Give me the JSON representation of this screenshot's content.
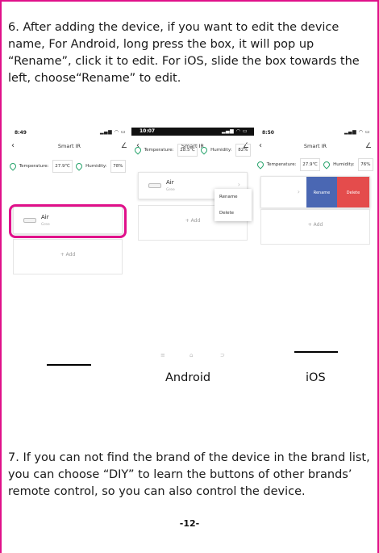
{
  "paragraphs": {
    "step6": "6. After adding the device, if you want to edit the device name, For Android, long press the box, it will pop up “Rename”, click it to edit. For iOS, slide the box towards the left, choose“Rename” to edit.",
    "step7": "7.  If you can not find the brand of the device in the brand list, you can choose “DIY” to learn the buttons of other brands’ remote control,  so you can also control the device."
  },
  "phones": {
    "ios_left": {
      "time": "8:49",
      "title": "Smart IR",
      "temperature_label": "Temperature:",
      "temperature_value": "27.9℃",
      "humidity_label": "Humidity:",
      "humidity_value": "78%",
      "device_name": "Air",
      "device_sub": "Gree",
      "add_label": "+ Add"
    },
    "android": {
      "time": "10:07",
      "title": "Smart IR",
      "temperature_label": "Temperature:",
      "temperature_value": "28.5℃",
      "humidity_label": "Humidity:",
      "humidity_value": "82%",
      "device_name": "Air",
      "device_sub": "Gree",
      "menu_rename": "Rename",
      "menu_delete": "Delete",
      "add_label": "+ Add"
    },
    "ios_right": {
      "time": "8:50",
      "title": "Smart IR",
      "temperature_label": "Temperature:",
      "temperature_value": "27.9℃",
      "humidity_label": "Humidity:",
      "humidity_value": "76%",
      "swipe_rename": "Rename",
      "swipe_delete": "Delete",
      "add_label": "+ Add"
    }
  },
  "captions": {
    "android": "Android",
    "ios": "iOS"
  },
  "page_number": "-12-",
  "colors": {
    "frame": "#e0108a",
    "rename_action": "#4a67b3",
    "delete_action": "#e44c4c",
    "humidity_icon": "#26a36b"
  }
}
